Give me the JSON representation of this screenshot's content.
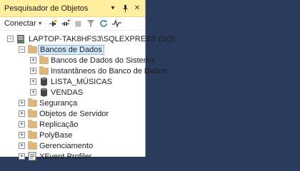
{
  "panel": {
    "title": "Pesquisador de Objetos",
    "title_buttons": {
      "dropdown": "▾",
      "pin": "⊣",
      "close": "✕"
    }
  },
  "toolbar": {
    "connect_label": "Conectar",
    "icons": [
      "connect-icon",
      "disconnect-icon",
      "stop-icon",
      "filter-icon",
      "refresh-icon",
      "activity-icon"
    ]
  },
  "tree": {
    "server": {
      "label": "LAPTOP-TAK8HFS3\\SQLEXPRESS (SQL",
      "expanded": "−"
    },
    "databases": {
      "label": "Bancos de Dados",
      "expanded": "−"
    },
    "db_children": [
      {
        "label": "Bancos de Dados do Sistema",
        "toggle": "+",
        "icon": "folder-icon"
      },
      {
        "label": "Instantâneos do Banco de Dados",
        "toggle": "+",
        "icon": "folder-icon"
      },
      {
        "label": "LISTA_MÚSICAS",
        "toggle": "+",
        "icon": "database-icon"
      },
      {
        "label": "VENDAS",
        "toggle": "+",
        "icon": "database-icon"
      }
    ],
    "server_children": [
      {
        "label": "Segurança",
        "toggle": "+",
        "icon": "folder-icon"
      },
      {
        "label": "Objetos de Servidor",
        "toggle": "+",
        "icon": "folder-icon"
      },
      {
        "label": "Replicação",
        "toggle": "+",
        "icon": "folder-icon"
      },
      {
        "label": "PolyBase",
        "toggle": "+",
        "icon": "folder-icon"
      },
      {
        "label": "Gerenciamento",
        "toggle": "+",
        "icon": "folder-icon"
      },
      {
        "label": "XEvent Profiler",
        "toggle": "+",
        "icon": "xevent-icon"
      }
    ]
  },
  "colors": {
    "title_bg": "#ffef9f",
    "selection_bg": "#cde8ff",
    "folder": "#dcb67a",
    "background": "#2b3b5c"
  }
}
